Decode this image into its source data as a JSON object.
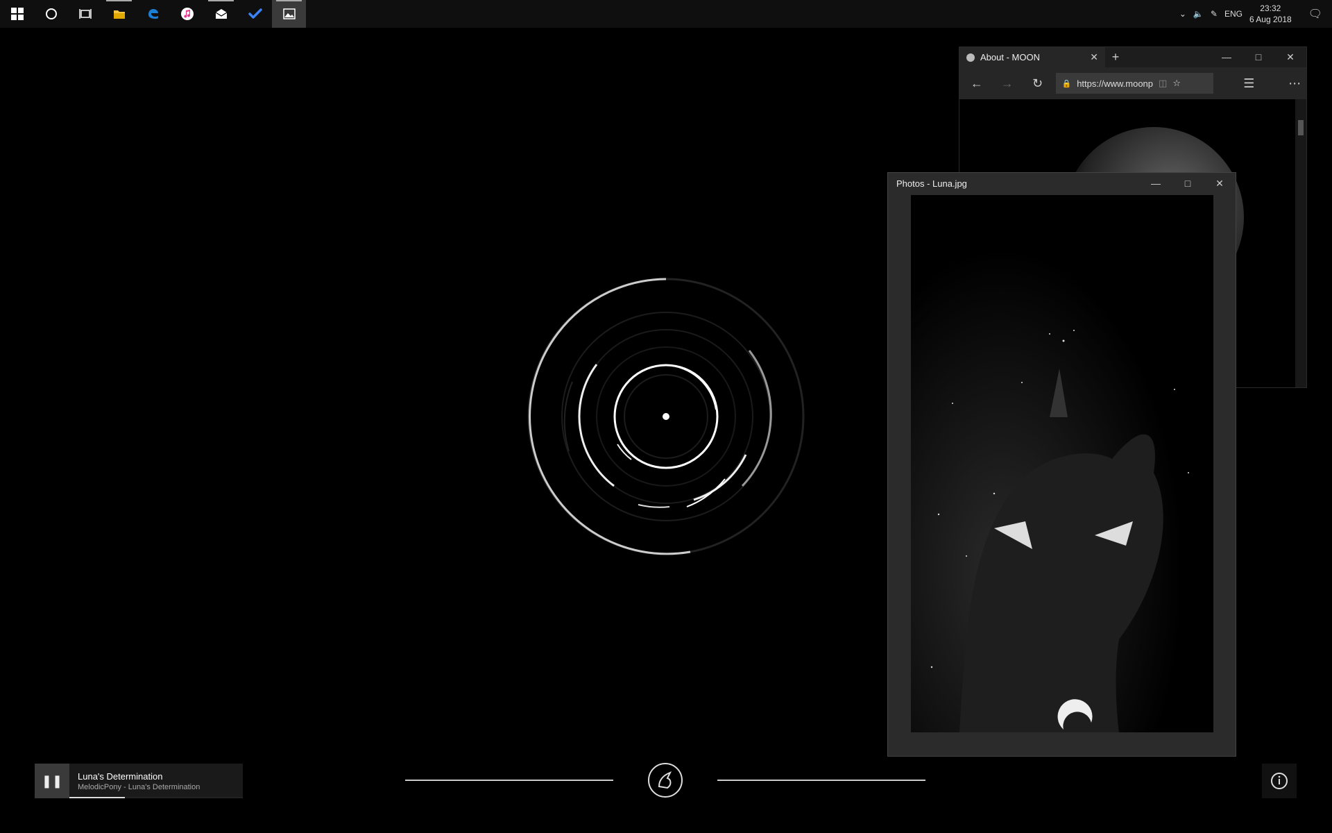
{
  "taskbar": {
    "icons": [
      {
        "name": "windows-start-icon"
      },
      {
        "name": "cortana-icon"
      },
      {
        "name": "task-view-icon"
      },
      {
        "name": "file-explorer-icon"
      },
      {
        "name": "edge-icon"
      },
      {
        "name": "itunes-icon"
      },
      {
        "name": "mail-icon"
      },
      {
        "name": "todo-check-icon"
      },
      {
        "name": "photos-icon"
      }
    ],
    "tray": {
      "language": "ENG",
      "time": "23:32",
      "date": "6 Aug 2018"
    }
  },
  "edge_window": {
    "tab_title": "About - MOON",
    "url": "https://www.moonp"
  },
  "photos_window": {
    "title": "Photos - Luna.jpg"
  },
  "player": {
    "track": "Luna's Determination",
    "artist_line": "MelodicPony - Luna's Determination",
    "progress": 0.32
  }
}
